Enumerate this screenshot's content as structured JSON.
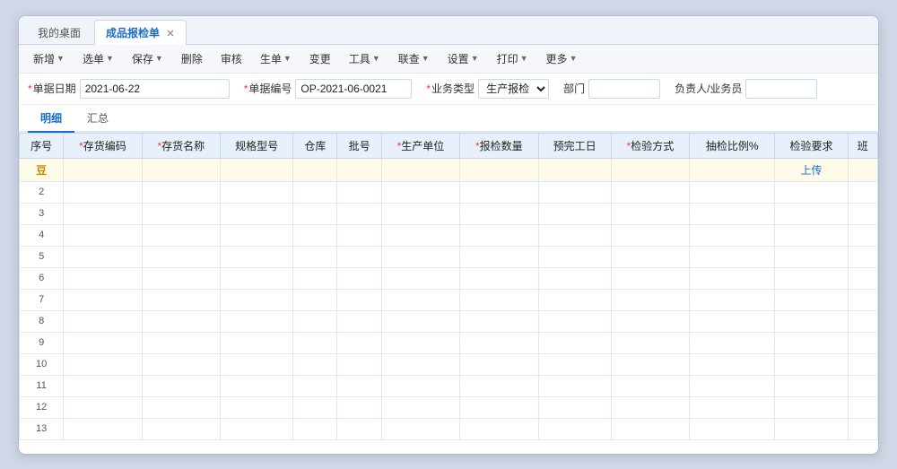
{
  "window": {
    "title": "成品报检单"
  },
  "tabs": [
    {
      "label": "我的桌面",
      "active": false,
      "closable": false
    },
    {
      "label": "成品报检单",
      "active": true,
      "closable": true
    }
  ],
  "toolbar": {
    "buttons": [
      {
        "label": "新增",
        "has_arrow": true
      },
      {
        "label": "选单",
        "has_arrow": true
      },
      {
        "label": "保存",
        "has_arrow": true
      },
      {
        "label": "删除",
        "has_arrow": false
      },
      {
        "label": "审核",
        "has_arrow": false
      },
      {
        "label": "生单",
        "has_arrow": true
      },
      {
        "label": "变更",
        "has_arrow": false
      },
      {
        "label": "工具",
        "has_arrow": true
      },
      {
        "label": "联查",
        "has_arrow": true
      },
      {
        "label": "设置",
        "has_arrow": true
      },
      {
        "label": "打印",
        "has_arrow": true
      },
      {
        "label": "更多",
        "has_arrow": true
      }
    ]
  },
  "form": {
    "fields": [
      {
        "label": "单据日期",
        "required": true,
        "value": "2021-06-22",
        "type": "text"
      },
      {
        "label": "单据编号",
        "required": true,
        "value": "OP-2021-06-0021",
        "type": "text"
      },
      {
        "label": "业务类型",
        "required": true,
        "value": "生产报检",
        "type": "select"
      },
      {
        "label": "部门",
        "required": false,
        "value": "",
        "type": "text"
      },
      {
        "label": "负责人/业务员",
        "required": false,
        "value": "",
        "type": "text"
      }
    ]
  },
  "sub_tabs": [
    {
      "label": "明细",
      "active": true
    },
    {
      "label": "汇总",
      "active": false
    }
  ],
  "table": {
    "columns": [
      {
        "label": "序号",
        "required": false
      },
      {
        "label": "存货编码",
        "required": true
      },
      {
        "label": "存货名称",
        "required": true
      },
      {
        "label": "规格型号",
        "required": false
      },
      {
        "label": "仓库",
        "required": false
      },
      {
        "label": "批号",
        "required": false
      },
      {
        "label": "生产单位",
        "required": true
      },
      {
        "label": "报检数量",
        "required": true
      },
      {
        "label": "预完工日",
        "required": false
      },
      {
        "label": "检验方式",
        "required": true
      },
      {
        "label": "抽检比例%",
        "required": false
      },
      {
        "label": "检验要求",
        "required": false
      },
      {
        "label": "班",
        "required": false
      }
    ],
    "rows": [
      {
        "num": "豆",
        "special": true,
        "upload": "上传"
      },
      {
        "num": "2"
      },
      {
        "num": "3"
      },
      {
        "num": "4"
      },
      {
        "num": "5"
      },
      {
        "num": "6"
      },
      {
        "num": "7"
      },
      {
        "num": "8"
      },
      {
        "num": "9"
      },
      {
        "num": "10"
      },
      {
        "num": "11"
      },
      {
        "num": "12"
      },
      {
        "num": "13"
      }
    ]
  }
}
